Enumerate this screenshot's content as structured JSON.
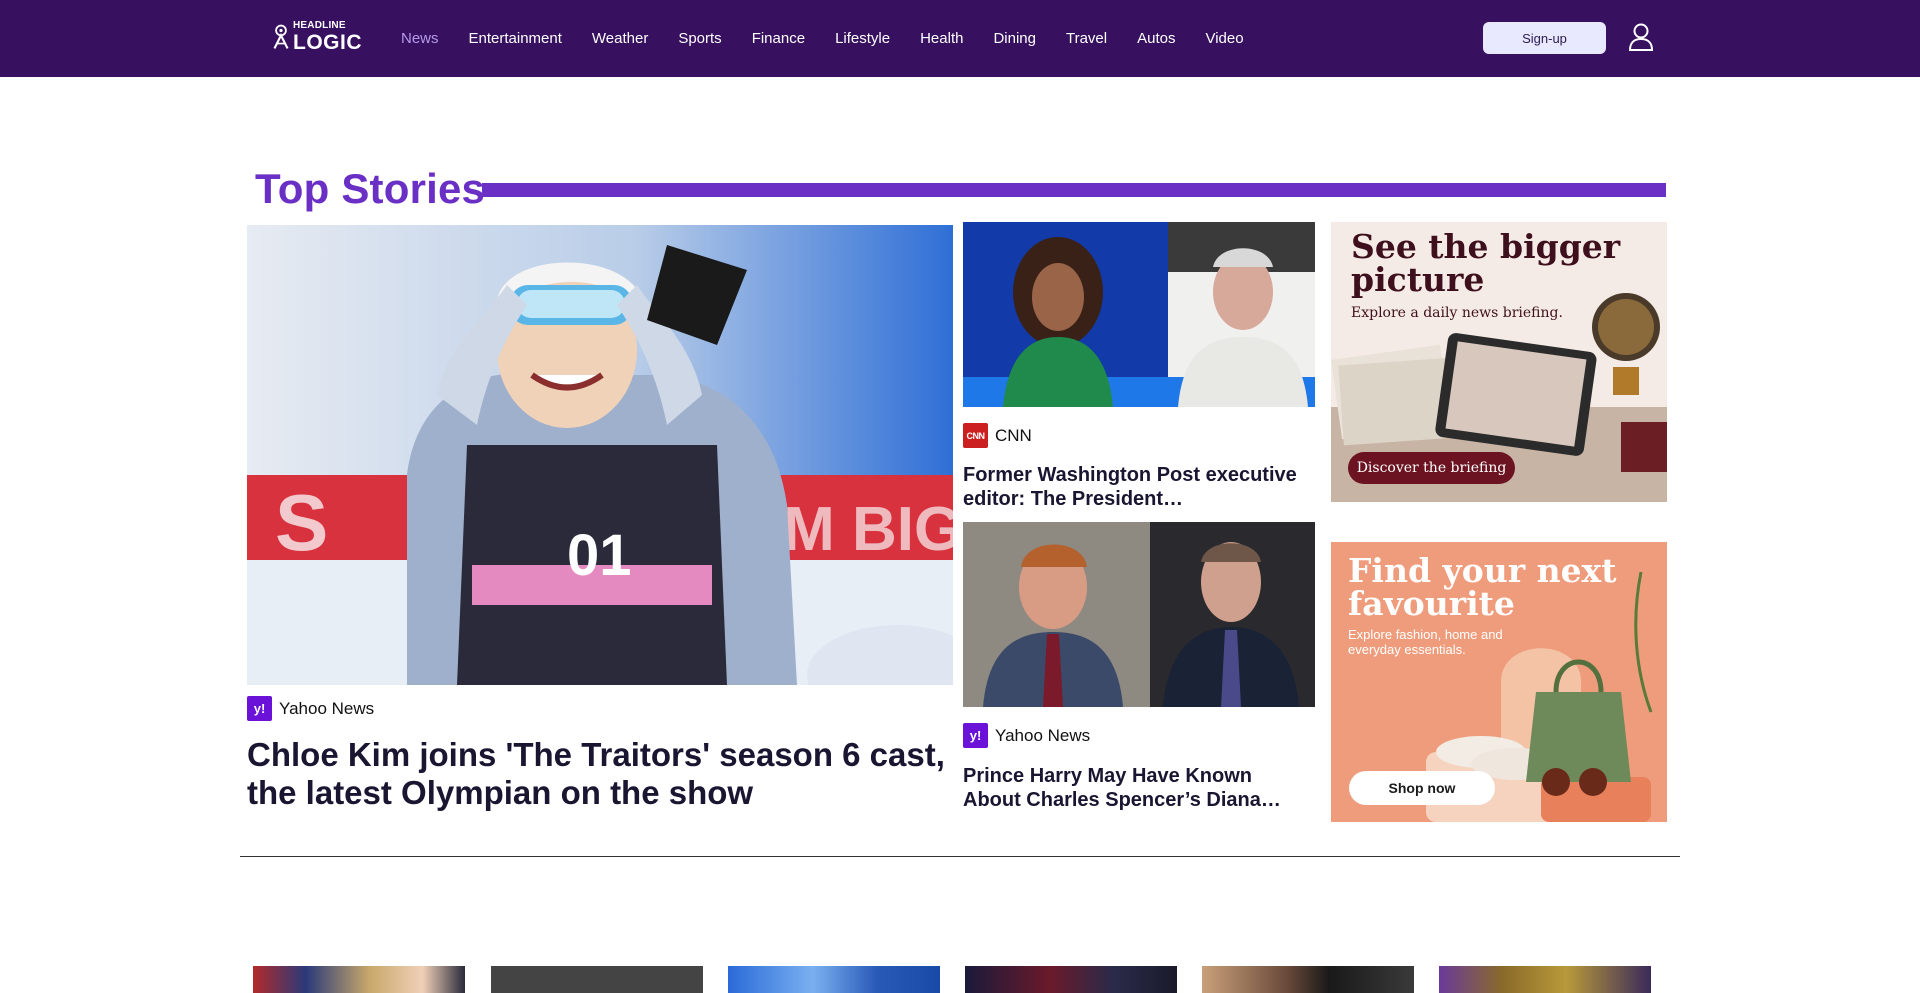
{
  "header": {
    "logo": {
      "top": "HEADLINE",
      "bottom": "LOGIC"
    },
    "nav": [
      "News",
      "Entertainment",
      "Weather",
      "Sports",
      "Finance",
      "Lifestyle",
      "Health",
      "Dining",
      "Travel",
      "Autos",
      "Video"
    ],
    "active_nav": "News",
    "signup_label": "Sign-up"
  },
  "section": {
    "title": "Top Stories"
  },
  "lead_story": {
    "source": "Yahoo News",
    "headline": "Chloe Kim joins 'The Traitors' season 6 cast, the latest Olympian on the show",
    "image_text": {
      "bib": "01",
      "banner_left": "S",
      "banner_right": "EAM BIG. DO"
    }
  },
  "stories": [
    {
      "source": "CNN",
      "source_badge": "CNN",
      "headline": "Former Washington Post executive editor: The President…"
    },
    {
      "source": "Yahoo News",
      "headline": "Prince Harry May Have Known About Charles Spencer’s Diana…"
    }
  ],
  "ads": [
    {
      "title": "See the bigger picture",
      "subtitle": "Explore a daily news briefing.",
      "button": "Discover the briefing"
    },
    {
      "title": "Find your next favourite",
      "subtitle": "Explore fashion, home and everyday essentials.",
      "button": "Shop now"
    }
  ],
  "colors": {
    "header_bg": "#37105f",
    "accent": "#6a2fc4",
    "active_nav": "#b59aea",
    "yahoo": "#6a12d8",
    "cnn": "#cc1f1f"
  }
}
